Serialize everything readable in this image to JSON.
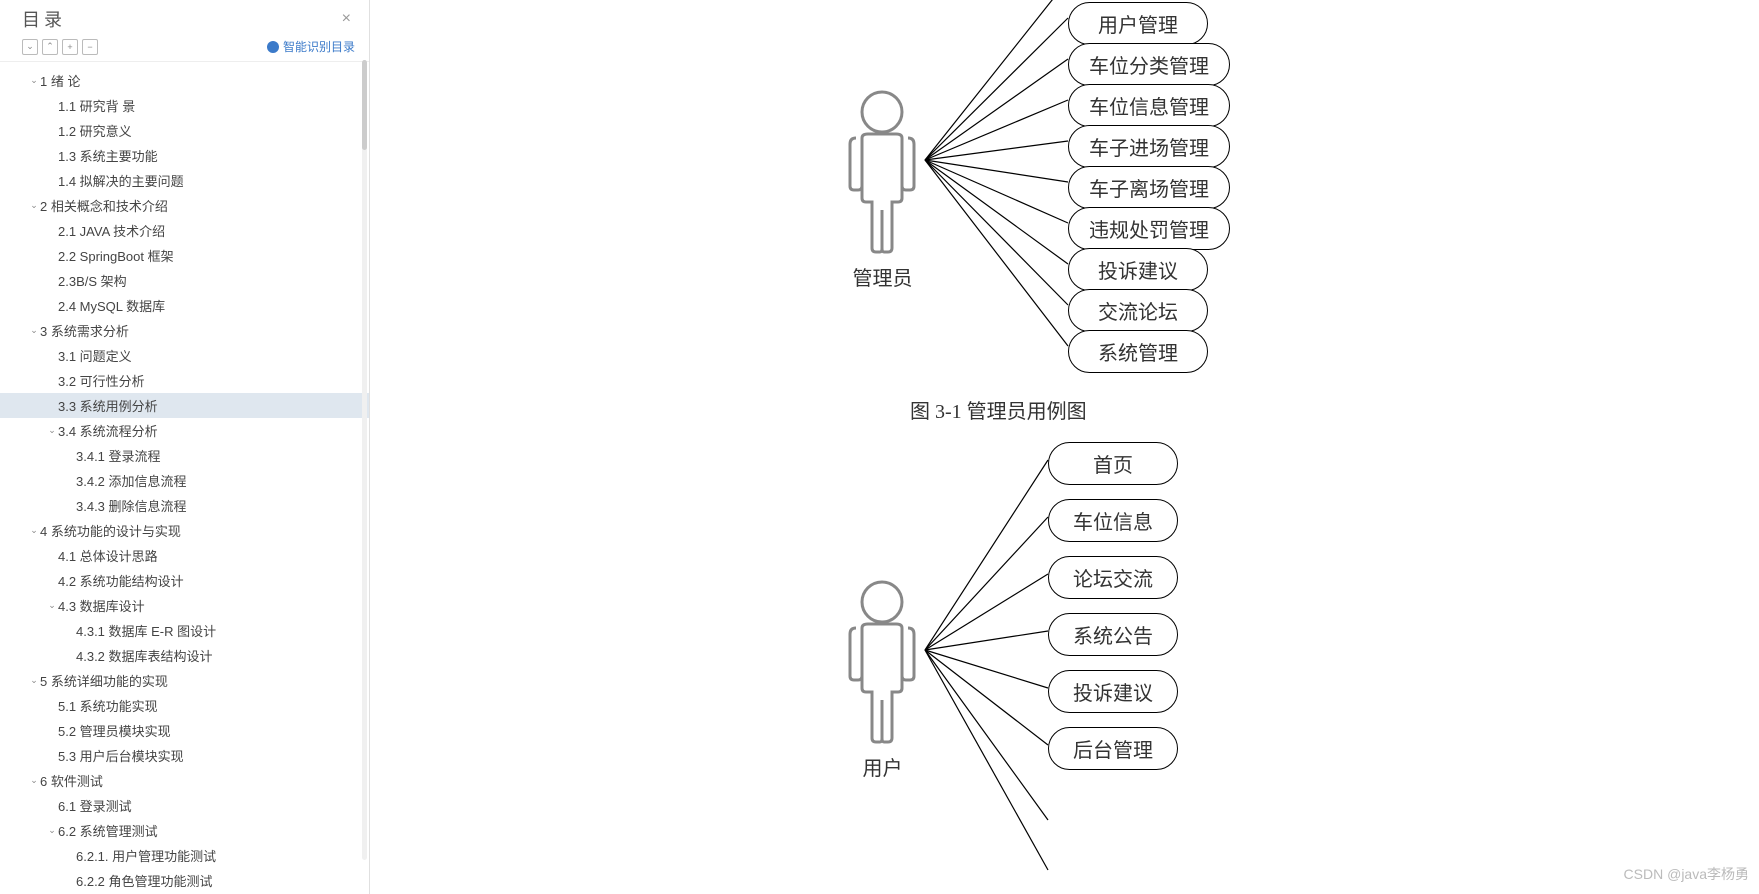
{
  "sidebar": {
    "title": "目录",
    "aiLink": "智能识别目录",
    "toolbar": [
      "⌄",
      "⌃",
      "+",
      "−"
    ],
    "tree": [
      {
        "indent": 0,
        "caret": "v",
        "label": "1 绪  论"
      },
      {
        "indent": 1,
        "caret": "",
        "label": "1.1 研究背 景"
      },
      {
        "indent": 1,
        "caret": "",
        "label": "1.2 研究意义"
      },
      {
        "indent": 1,
        "caret": "",
        "label": "1.3 系统主要功能"
      },
      {
        "indent": 1,
        "caret": "",
        "label": "1.4 拟解决的主要问题"
      },
      {
        "indent": 0,
        "caret": "v",
        "label": "2 相关概念和技术介绍"
      },
      {
        "indent": 1,
        "caret": "",
        "label": "2.1 JAVA 技术介绍"
      },
      {
        "indent": 1,
        "caret": "",
        "label": "2.2 SpringBoot 框架"
      },
      {
        "indent": 1,
        "caret": "",
        "label": "2.3B/S 架构"
      },
      {
        "indent": 1,
        "caret": "",
        "label": "2.4 MySQL 数据库"
      },
      {
        "indent": 0,
        "caret": "v",
        "label": "3 系统需求分析"
      },
      {
        "indent": 1,
        "caret": "",
        "label": "3.1 问题定义"
      },
      {
        "indent": 1,
        "caret": "",
        "label": "3.2 可行性分析"
      },
      {
        "indent": 1,
        "caret": "",
        "label": "3.3 系统用例分析",
        "selected": true
      },
      {
        "indent": 1,
        "caret": "v",
        "label": "3.4 系统流程分析"
      },
      {
        "indent": 2,
        "caret": "",
        "label": "3.4.1 登录流程"
      },
      {
        "indent": 2,
        "caret": "",
        "label": "3.4.2 添加信息流程"
      },
      {
        "indent": 2,
        "caret": "",
        "label": "3.4.3 删除信息流程"
      },
      {
        "indent": 0,
        "caret": "v",
        "label": "4 系统功能的设计与实现"
      },
      {
        "indent": 1,
        "caret": "",
        "label": "4.1 总体设计思路"
      },
      {
        "indent": 1,
        "caret": "",
        "label": "4.2 系统功能结构设计"
      },
      {
        "indent": 1,
        "caret": "v",
        "label": "4.3 数据库设计"
      },
      {
        "indent": 2,
        "caret": "",
        "label": "4.3.1 数据库 E-R 图设计"
      },
      {
        "indent": 2,
        "caret": "",
        "label": "4.3.2 数据库表结构设计"
      },
      {
        "indent": 0,
        "caret": "v",
        "label": "5 系统详细功能的实现"
      },
      {
        "indent": 1,
        "caret": "",
        "label": "5.1 系统功能实现"
      },
      {
        "indent": 1,
        "caret": "",
        "label": "5.2 管理员模块实现"
      },
      {
        "indent": 1,
        "caret": "",
        "label": "5.3 用户后台模块实现"
      },
      {
        "indent": 0,
        "caret": "v",
        "label": "6 软件测试"
      },
      {
        "indent": 1,
        "caret": "",
        "label": "6.1 登录测试"
      },
      {
        "indent": 1,
        "caret": "v",
        "label": "6.2 系统管理测试"
      },
      {
        "indent": 2,
        "caret": "",
        "label": "6.2.1. 用户管理功能测试"
      },
      {
        "indent": 2,
        "caret": "",
        "label": "6.2.2 角色管理功能测试"
      }
    ]
  },
  "diagram1": {
    "actorLabel": "管理员",
    "caption": "图 3-1  管理员用例图",
    "usecases": [
      "用户管理",
      "车位分类管理",
      "车位信息管理",
      "车子进场管理",
      "车子离场管理",
      "违规处罚管理",
      "投诉建议",
      "交流论坛",
      "系统管理"
    ]
  },
  "diagram2": {
    "actorLabel": "用户",
    "usecases": [
      "首页",
      "车位信息",
      "论坛交流",
      "系统公告",
      "投诉建议",
      "后台管理"
    ]
  },
  "watermark": "CSDN @java李杨勇"
}
